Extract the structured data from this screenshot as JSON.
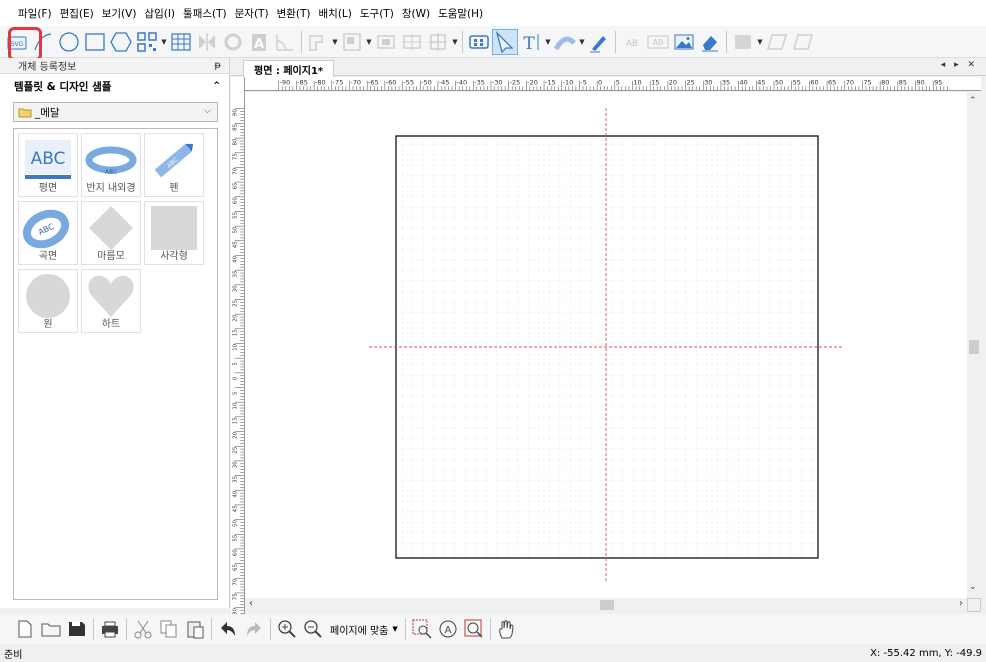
{
  "menu": [
    "파일(F)",
    "편집(E)",
    "보기(V)",
    "삽입(I)",
    "툴패스(T)",
    "문자(T)",
    "변환(T)",
    "배치(L)",
    "도구(T)",
    "창(W)",
    "도움말(H)"
  ],
  "left_panel": {
    "title": "개체 등록정보",
    "pin": "ᵽ",
    "subtitle": "템플릿 & 디자인 샘플",
    "collapse": "⌃",
    "folder": "_메달",
    "tiles": [
      "평면",
      "반지 내외경",
      "펜",
      "곡면",
      "마름모",
      "사각형",
      "원",
      "하트"
    ],
    "thumb_texts": {
      "flat": "ABC",
      "ring_small": "ABC",
      "pen": "ABC",
      "curve": "ABC"
    }
  },
  "document": {
    "tab": "평면 : 페이지1*",
    "tab_nav": "◂ ▸ ✕",
    "ruler_h_labels": [
      "-90",
      "-85",
      "-80",
      "-75",
      "-70",
      "-65",
      "-60",
      "-55",
      "-50",
      "-45",
      "-40",
      "-35",
      "-30",
      "-25",
      "-20",
      "-15",
      "-10",
      "-5",
      "0",
      "5",
      "10",
      "15",
      "20",
      "25",
      "30",
      "35",
      "40",
      "45",
      "50",
      "55",
      "60",
      "65",
      "70",
      "75",
      "80",
      "85",
      "90",
      "95"
    ],
    "ruler_v_labels": [
      "90",
      "85",
      "80",
      "75",
      "70",
      "65",
      "60",
      "55",
      "50",
      "45",
      "40",
      "35",
      "30",
      "25",
      "20",
      "15",
      "10",
      "5",
      "0",
      "5",
      "10",
      "15",
      "20",
      "25",
      "30",
      "35",
      "40",
      "45",
      "50",
      "55",
      "60",
      "65",
      "70",
      "75",
      "80",
      "85"
    ],
    "ruler_corner": "%"
  },
  "bottom_toolbar": {
    "fit_label": "페이지에 맞춤"
  },
  "toolbar_text": {
    "svg": "SVG",
    "text_tool": "T",
    "ab1": "AB",
    "ab2": "AB"
  },
  "status": {
    "left": "준비",
    "coords": "X: -55.42 mm,  Y: -49.9"
  },
  "colors": {
    "accent": "#3a78c8",
    "highlight": "#e0383e",
    "guide": "#e05050"
  }
}
